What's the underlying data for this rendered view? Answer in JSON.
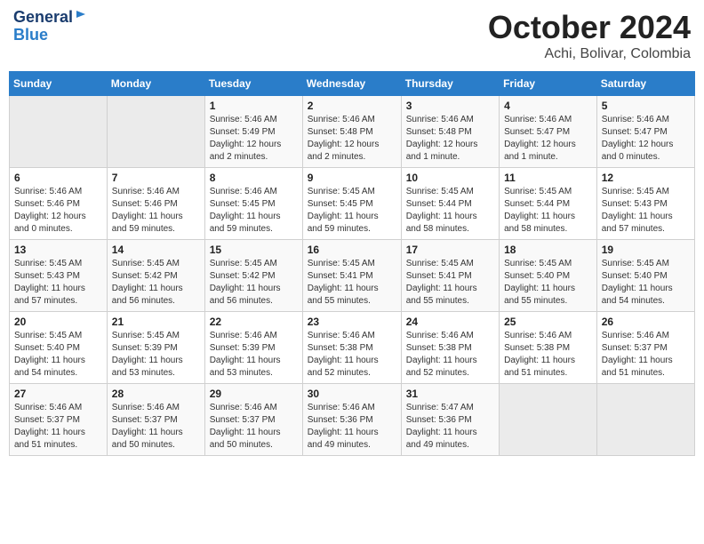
{
  "header": {
    "logo_line1": "General",
    "logo_line2": "Blue",
    "title": "October 2024",
    "subtitle": "Achi, Bolivar, Colombia"
  },
  "weekdays": [
    "Sunday",
    "Monday",
    "Tuesday",
    "Wednesday",
    "Thursday",
    "Friday",
    "Saturday"
  ],
  "weeks": [
    [
      {
        "day": "",
        "info": ""
      },
      {
        "day": "",
        "info": ""
      },
      {
        "day": "1",
        "info": "Sunrise: 5:46 AM\nSunset: 5:49 PM\nDaylight: 12 hours\nand 2 minutes."
      },
      {
        "day": "2",
        "info": "Sunrise: 5:46 AM\nSunset: 5:48 PM\nDaylight: 12 hours\nand 2 minutes."
      },
      {
        "day": "3",
        "info": "Sunrise: 5:46 AM\nSunset: 5:48 PM\nDaylight: 12 hours\nand 1 minute."
      },
      {
        "day": "4",
        "info": "Sunrise: 5:46 AM\nSunset: 5:47 PM\nDaylight: 12 hours\nand 1 minute."
      },
      {
        "day": "5",
        "info": "Sunrise: 5:46 AM\nSunset: 5:47 PM\nDaylight: 12 hours\nand 0 minutes."
      }
    ],
    [
      {
        "day": "6",
        "info": "Sunrise: 5:46 AM\nSunset: 5:46 PM\nDaylight: 12 hours\nand 0 minutes."
      },
      {
        "day": "7",
        "info": "Sunrise: 5:46 AM\nSunset: 5:46 PM\nDaylight: 11 hours\nand 59 minutes."
      },
      {
        "day": "8",
        "info": "Sunrise: 5:46 AM\nSunset: 5:45 PM\nDaylight: 11 hours\nand 59 minutes."
      },
      {
        "day": "9",
        "info": "Sunrise: 5:45 AM\nSunset: 5:45 PM\nDaylight: 11 hours\nand 59 minutes."
      },
      {
        "day": "10",
        "info": "Sunrise: 5:45 AM\nSunset: 5:44 PM\nDaylight: 11 hours\nand 58 minutes."
      },
      {
        "day": "11",
        "info": "Sunrise: 5:45 AM\nSunset: 5:44 PM\nDaylight: 11 hours\nand 58 minutes."
      },
      {
        "day": "12",
        "info": "Sunrise: 5:45 AM\nSunset: 5:43 PM\nDaylight: 11 hours\nand 57 minutes."
      }
    ],
    [
      {
        "day": "13",
        "info": "Sunrise: 5:45 AM\nSunset: 5:43 PM\nDaylight: 11 hours\nand 57 minutes."
      },
      {
        "day": "14",
        "info": "Sunrise: 5:45 AM\nSunset: 5:42 PM\nDaylight: 11 hours\nand 56 minutes."
      },
      {
        "day": "15",
        "info": "Sunrise: 5:45 AM\nSunset: 5:42 PM\nDaylight: 11 hours\nand 56 minutes."
      },
      {
        "day": "16",
        "info": "Sunrise: 5:45 AM\nSunset: 5:41 PM\nDaylight: 11 hours\nand 55 minutes."
      },
      {
        "day": "17",
        "info": "Sunrise: 5:45 AM\nSunset: 5:41 PM\nDaylight: 11 hours\nand 55 minutes."
      },
      {
        "day": "18",
        "info": "Sunrise: 5:45 AM\nSunset: 5:40 PM\nDaylight: 11 hours\nand 55 minutes."
      },
      {
        "day": "19",
        "info": "Sunrise: 5:45 AM\nSunset: 5:40 PM\nDaylight: 11 hours\nand 54 minutes."
      }
    ],
    [
      {
        "day": "20",
        "info": "Sunrise: 5:45 AM\nSunset: 5:40 PM\nDaylight: 11 hours\nand 54 minutes."
      },
      {
        "day": "21",
        "info": "Sunrise: 5:45 AM\nSunset: 5:39 PM\nDaylight: 11 hours\nand 53 minutes."
      },
      {
        "day": "22",
        "info": "Sunrise: 5:46 AM\nSunset: 5:39 PM\nDaylight: 11 hours\nand 53 minutes."
      },
      {
        "day": "23",
        "info": "Sunrise: 5:46 AM\nSunset: 5:38 PM\nDaylight: 11 hours\nand 52 minutes."
      },
      {
        "day": "24",
        "info": "Sunrise: 5:46 AM\nSunset: 5:38 PM\nDaylight: 11 hours\nand 52 minutes."
      },
      {
        "day": "25",
        "info": "Sunrise: 5:46 AM\nSunset: 5:38 PM\nDaylight: 11 hours\nand 51 minutes."
      },
      {
        "day": "26",
        "info": "Sunrise: 5:46 AM\nSunset: 5:37 PM\nDaylight: 11 hours\nand 51 minutes."
      }
    ],
    [
      {
        "day": "27",
        "info": "Sunrise: 5:46 AM\nSunset: 5:37 PM\nDaylight: 11 hours\nand 51 minutes."
      },
      {
        "day": "28",
        "info": "Sunrise: 5:46 AM\nSunset: 5:37 PM\nDaylight: 11 hours\nand 50 minutes."
      },
      {
        "day": "29",
        "info": "Sunrise: 5:46 AM\nSunset: 5:37 PM\nDaylight: 11 hours\nand 50 minutes."
      },
      {
        "day": "30",
        "info": "Sunrise: 5:46 AM\nSunset: 5:36 PM\nDaylight: 11 hours\nand 49 minutes."
      },
      {
        "day": "31",
        "info": "Sunrise: 5:47 AM\nSunset: 5:36 PM\nDaylight: 11 hours\nand 49 minutes."
      },
      {
        "day": "",
        "info": ""
      },
      {
        "day": "",
        "info": ""
      }
    ]
  ]
}
